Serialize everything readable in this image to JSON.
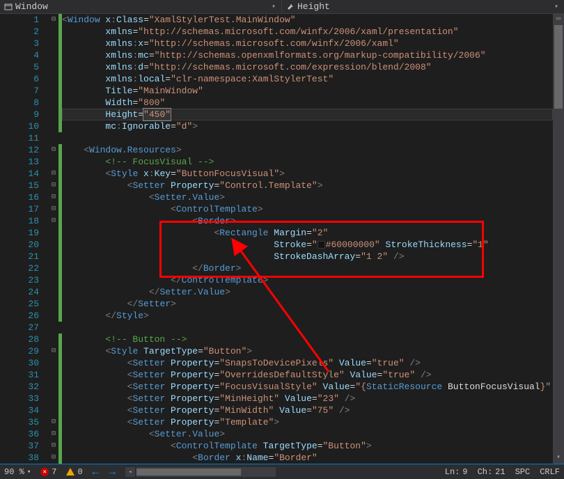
{
  "toolbar": {
    "left_label": "Window",
    "right_label": "Height"
  },
  "lines": [
    1,
    2,
    3,
    4,
    5,
    6,
    7,
    8,
    9,
    10,
    11,
    12,
    13,
    14,
    15,
    16,
    17,
    18,
    19,
    20,
    21,
    22,
    23,
    24,
    25,
    26,
    27,
    28,
    29,
    30,
    31,
    32,
    33,
    34,
    35,
    36,
    37,
    38
  ],
  "code": {
    "l1": {
      "open": "<",
      "tag": "Window ",
      "a1": "x",
      "c1": ":",
      "a2": "Class",
      "eq": "=",
      "v": "\"XamlStylerTest.MainWindow\""
    },
    "l2": {
      "a": "xmlns",
      "eq": "=",
      "v": "\"http://schemas.microsoft.com/winfx/2006/xaml/presentation\""
    },
    "l3": {
      "a": "xmlns",
      "c": ":",
      "a2": "x",
      "eq": "=",
      "v": "\"http://schemas.microsoft.com/winfx/2006/xaml\""
    },
    "l4": {
      "a": "xmlns",
      "c": ":",
      "a2": "mc",
      "eq": "=",
      "v": "\"http://schemas.openxmlformats.org/markup-compatibility/2006\""
    },
    "l5": {
      "a": "xmlns",
      "c": ":",
      "a2": "d",
      "eq": "=",
      "v": "\"http://schemas.microsoft.com/expression/blend/2008\""
    },
    "l6": {
      "a": "xmlns",
      "c": ":",
      "a2": "local",
      "eq": "=",
      "v": "\"clr-namespace:XamlStylerTest\""
    },
    "l7": {
      "a": "Title",
      "eq": "=",
      "v": "\"MainWindow\""
    },
    "l8": {
      "a": "Width",
      "eq": "=",
      "v": "\"800\""
    },
    "l9": {
      "a": "Height",
      "eq": "=",
      "v": "\"450\""
    },
    "l10": {
      "a": "mc",
      "c": ":",
      "a2": "Ignorable",
      "eq": "=",
      "v": "\"d\"",
      "close": ">"
    },
    "l12": {
      "open": "<",
      "tag": "Window.Resources",
      "close": ">"
    },
    "l13c": "<!-- FocusVisual -->",
    "l14": {
      "open": "<",
      "tag": "Style ",
      "a": "x",
      "c": ":",
      "a2": "Key",
      "eq": "=",
      "v": "\"ButtonFocusVisual\"",
      "close": ">"
    },
    "l15": {
      "open": "<",
      "tag": "Setter ",
      "a": "Property",
      "eq": "=",
      "v": "\"Control.Template\"",
      "close": ">"
    },
    "l16": {
      "open": "<",
      "tag": "Setter.Value",
      "close": ">"
    },
    "l17": {
      "open": "<",
      "tag": "ControlTemplate",
      "close": ">"
    },
    "l18": {
      "open": "<",
      "tag": "Border",
      "close": ">"
    },
    "l19": {
      "open": "<",
      "tag": "Rectangle ",
      "a": "Margin",
      "eq": "=",
      "v": "\"2\""
    },
    "l20": {
      "a": "Stroke",
      "eq": "=",
      "v1": "\"",
      "v2": "#60000000\" ",
      "a2": "StrokeThickness",
      "eq2": "=",
      "v3": "\"1\""
    },
    "l21": {
      "a": "StrokeDashArray",
      "eq": "=",
      "v": "\"1 2\" ",
      "close": "/>"
    },
    "l22": {
      "open": "</",
      "tag": "Border",
      "close": ">"
    },
    "l23": {
      "open": "</",
      "tag": "ControlTemplate",
      "close": ">"
    },
    "l24": {
      "open": "</",
      "tag": "Setter.Value",
      "close": ">"
    },
    "l25": {
      "open": "</",
      "tag": "Setter",
      "close": ">"
    },
    "l26": {
      "open": "</",
      "tag": "Style",
      "close": ">"
    },
    "l28c": "<!-- Button -->",
    "l29": {
      "open": "<",
      "tag": "Style ",
      "a": "TargetType",
      "eq": "=",
      "v": "\"Button\"",
      "close": ">"
    },
    "l30": {
      "open": "<",
      "tag": "Setter ",
      "a": "Property",
      "eq": "=",
      "v": "\"SnapsToDevicePixels\" ",
      "a2": "Value",
      "eq2": "=",
      "v2": "\"true\" ",
      "close": "/>"
    },
    "l31": {
      "open": "<",
      "tag": "Setter ",
      "a": "Property",
      "eq": "=",
      "v": "\"OverridesDefaultStyle\" ",
      "a2": "Value",
      "eq2": "=",
      "v2": "\"true\" ",
      "close": "/>"
    },
    "l32": {
      "open": "<",
      "tag": "Setter ",
      "a": "Property",
      "eq": "=",
      "v": "\"FocusVisualStyle\" ",
      "a2": "Value",
      "eq2": "=",
      "v2p": "\"{",
      "sr": "StaticResource ",
      "res": "ButtonFocusVisual",
      "v2s": "}\" ",
      "close": "/>"
    },
    "l33": {
      "open": "<",
      "tag": "Setter ",
      "a": "Property",
      "eq": "=",
      "v": "\"MinHeight\" ",
      "a2": "Value",
      "eq2": "=",
      "v2": "\"23\" ",
      "close": "/>"
    },
    "l34": {
      "open": "<",
      "tag": "Setter ",
      "a": "Property",
      "eq": "=",
      "v": "\"MinWidth\" ",
      "a2": "Value",
      "eq2": "=",
      "v2": "\"75\" ",
      "close": "/>"
    },
    "l35": {
      "open": "<",
      "tag": "Setter ",
      "a": "Property",
      "eq": "=",
      "v": "\"Template\"",
      "close": ">"
    },
    "l36": {
      "open": "<",
      "tag": "Setter.Value",
      "close": ">"
    },
    "l37": {
      "open": "<",
      "tag": "ControlTemplate ",
      "a": "TargetType",
      "eq": "=",
      "v": "\"Button\"",
      "close": ">"
    },
    "l38": {
      "open": "<",
      "tag": "Border ",
      "a": "x",
      "c": ":",
      "a2": "Name",
      "eq": "=",
      "v": "\"Border\""
    }
  },
  "status": {
    "zoom": "90 %",
    "errors": "7",
    "warnings": "0",
    "ln_label": "Ln:",
    "ln": "9",
    "ch_label": "Ch:",
    "ch": "21",
    "spc": "SPC",
    "crlf": "CRLF"
  }
}
